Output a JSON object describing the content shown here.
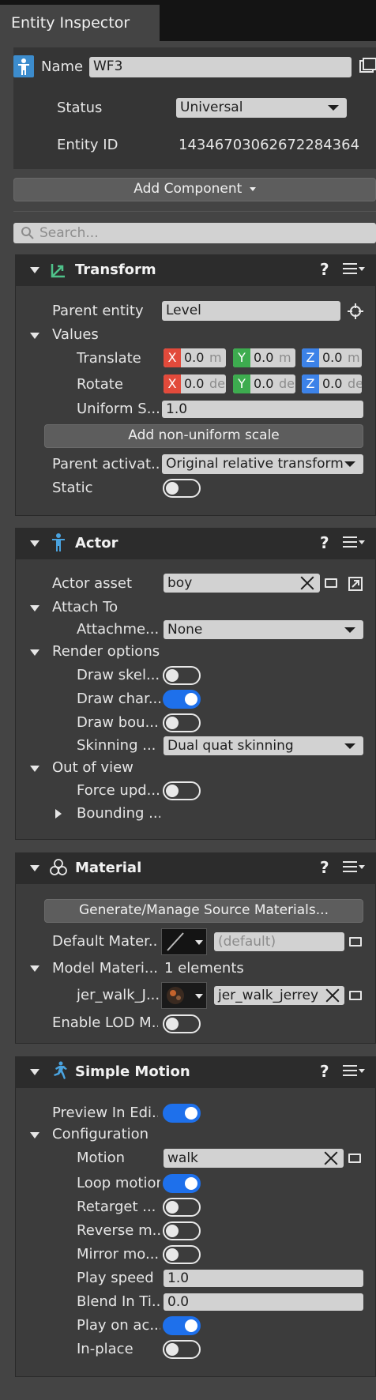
{
  "tab": {
    "title": "Entity Inspector"
  },
  "entity": {
    "name_label": "Name",
    "name_value": "WF3",
    "status_label": "Status",
    "status_value": "Universal",
    "id_label": "Entity ID",
    "id_value": "14346703062672284364"
  },
  "add_component_label": "Add Component",
  "search_placeholder": "Search...",
  "transform": {
    "title": "Transform",
    "help": "?",
    "parent_entity_label": "Parent entity",
    "parent_entity_value": "Level",
    "values_label": "Values",
    "translate_label": "Translate",
    "rotate_label": "Rotate",
    "uniform_label": "Uniform S...",
    "uniform_value": "1.0",
    "axis_x": "X",
    "axis_y": "Y",
    "axis_z": "Z",
    "translate": {
      "x": "0.0",
      "y": "0.0",
      "z": "0.0",
      "unit": "m"
    },
    "rotate": {
      "x": "0.0",
      "y": "0.0",
      "z": "0.0",
      "unit": "de"
    },
    "nonuniform_button": "Add non-uniform scale",
    "parent_activation_label": "Parent activat...",
    "parent_activation_value": "Original relative transform",
    "static_label": "Static"
  },
  "actor": {
    "title": "Actor",
    "help": "?",
    "asset_label": "Actor asset",
    "asset_value": "boy",
    "attach_to_label": "Attach To",
    "attachment_label": "Attachme...",
    "attachment_value": "None",
    "render_options_label": "Render options",
    "draw_skeleton_label": "Draw skel...",
    "draw_character_label": "Draw char...",
    "draw_bounds_label": "Draw bou...",
    "skinning_label": "Skinning ...",
    "skinning_value": "Dual quat skinning",
    "out_of_view_label": "Out of view",
    "force_update_label": "Force upd...",
    "bounding_label": "Bounding ..."
  },
  "material": {
    "title": "Material",
    "help": "?",
    "generate_button": "Generate/Manage Source Materials...",
    "default_label": "Default Mater...",
    "default_value": "(default)",
    "model_label": "Model Materi...",
    "model_count": "1 elements",
    "item_label": "jer_walk_J...",
    "item_value": "jer_walk_jerrey",
    "lod_label": "Enable LOD M..."
  },
  "motion": {
    "title": "Simple Motion",
    "help": "?",
    "preview_label": "Preview In Edi...",
    "configuration_label": "Configuration",
    "motion_label": "Motion",
    "motion_value": "walk",
    "loop_label": "Loop motion",
    "retarget_label": "Retarget ...",
    "reverse_label": "Reverse m...",
    "mirror_label": "Mirror mo...",
    "speed_label": "Play speed",
    "speed_value": "1.0",
    "blend_label": "Blend In Ti...",
    "blend_value": "0.0",
    "play_on_label": "Play on ac...",
    "inplace_label": "In-place"
  },
  "toggles": {
    "static": false,
    "draw_skeleton": false,
    "draw_character": true,
    "draw_bounds": false,
    "force_update": false,
    "enable_lod": false,
    "preview": true,
    "loop": true,
    "retarget": false,
    "reverse": false,
    "mirror": false,
    "play_on_activation": true,
    "in_place": false
  },
  "colors": {
    "accent": "#1e70eb",
    "axis_x": "#e24a3b",
    "axis_y": "#3dac4f",
    "axis_z": "#3c82e8",
    "transform_icon": "#4fc28a",
    "actor_icon": "#4aa3df"
  }
}
